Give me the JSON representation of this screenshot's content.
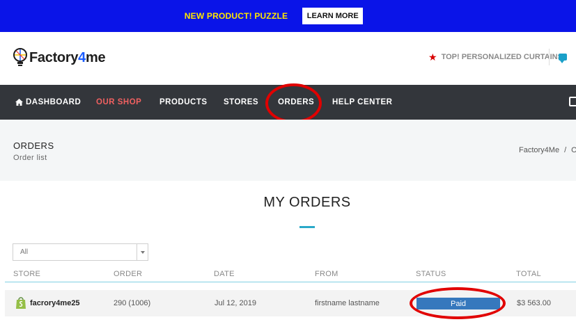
{
  "promo": {
    "text": "NEW PRODUCT!  PUZZLE",
    "button_label": "LEARN MORE"
  },
  "header": {
    "logo_main": "Factory",
    "logo_accent": "4",
    "logo_tail": "me",
    "top_promo": "TOP! PERSONALIZED CURTAINS"
  },
  "nav": {
    "items": [
      {
        "label": "DASHBOARD"
      },
      {
        "label": "OUR SHOP"
      },
      {
        "label": "PRODUCTS"
      },
      {
        "label": "STORES"
      },
      {
        "label": "ORDERS"
      },
      {
        "label": "HELP CENTER"
      }
    ]
  },
  "page": {
    "title": "ORDERS",
    "subtitle": "Order list",
    "breadcrumb": [
      "Factory4Me",
      "/",
      "O"
    ]
  },
  "orders": {
    "heading": "MY ORDERS",
    "filter_value": "All",
    "columns": [
      "STORE",
      "ORDER",
      "DATE",
      "FROM",
      "STATUS",
      "TOTAL"
    ],
    "rows": [
      {
        "store": "facrory4me25",
        "order": "290 (1006)",
        "date": "Jul 12, 2019",
        "from": "firstname lastname",
        "status": "Paid",
        "total": "$3 563.00"
      }
    ]
  },
  "colors": {
    "promo_bg": "#0a14e8",
    "promo_text": "#ffe600",
    "nav_bg": "#33363b",
    "nav_active": "#f06060",
    "accent": "#2aa9c9",
    "status_paid": "#3678bd",
    "annotation": "#e10000"
  }
}
